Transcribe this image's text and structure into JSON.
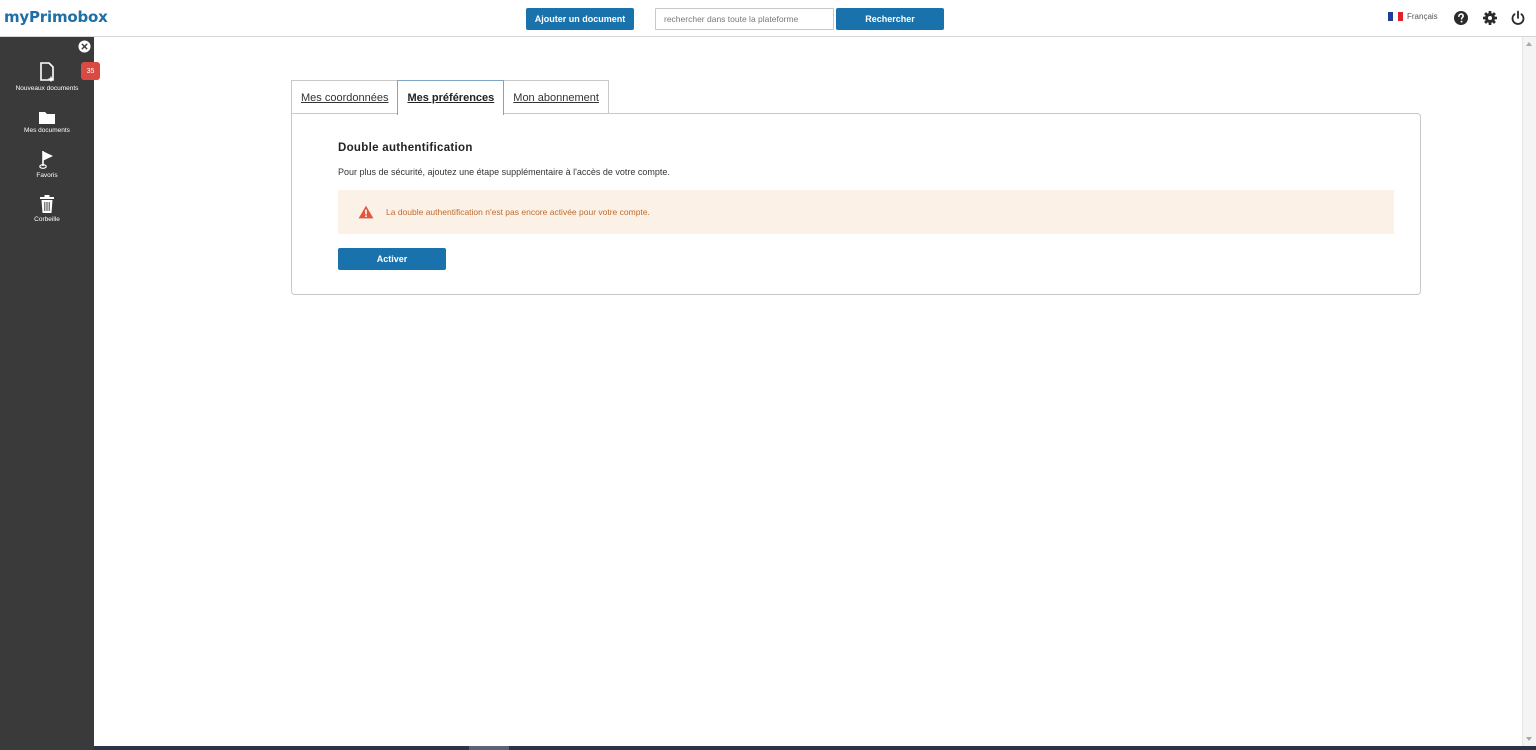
{
  "header": {
    "logo": "myPrimobox",
    "add_document_label": "Ajouter un document",
    "search_placeholder": "rechercher dans toute la plateforme",
    "search_button_label": "Rechercher",
    "language": "Français",
    "icons": [
      "help-icon",
      "gear-icon",
      "power-icon"
    ]
  },
  "sidebar": {
    "items": [
      {
        "label": "Nouveaux documents",
        "icon": "new-document-icon",
        "badge": "35"
      },
      {
        "label": "Mes documents",
        "icon": "folder-icon"
      },
      {
        "label": "Favoris",
        "icon": "flag-icon"
      },
      {
        "label": "Corbeille",
        "icon": "trash-icon"
      }
    ]
  },
  "main": {
    "tabs": [
      {
        "label": "Mes coordonnées",
        "active": false
      },
      {
        "label": "Mes préférences",
        "active": true
      },
      {
        "label": "Mon abonnement",
        "active": false
      }
    ],
    "section": {
      "title": "Double authentification",
      "description": "Pour plus de sécurité, ajoutez une étape supplémentaire à l'accès de votre compte.",
      "alert": "La double authentification n'est pas encore activée pour votre compte.",
      "button_label": "Activer"
    }
  },
  "colors": {
    "brand_blue": "#1a72ad",
    "sidebar_bg": "#3a3a3a",
    "badge_red": "#d94a43",
    "alert_bg": "#fcf1e7",
    "alert_text": "#c26a2a",
    "alert_icon": "#e2553f"
  }
}
